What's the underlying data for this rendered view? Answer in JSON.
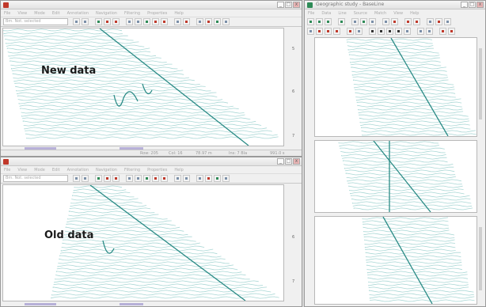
{
  "windows": {
    "new": {
      "menu": [
        "File",
        "View",
        "Mode",
        "Edit",
        "Annotation",
        "Navigation",
        "Filtering",
        "Properties",
        "Help"
      ],
      "combo": "Bm. Not. selected",
      "overlay_label": "New data",
      "depth_labels": [
        "5",
        "6",
        "7"
      ],
      "status": [
        "Row: 205",
        "Col: 16",
        "78.97 m",
        "Ins: 7 Bla",
        "991.0 s"
      ]
    },
    "old": {
      "menu": [
        "File",
        "View",
        "Mode",
        "Edit",
        "Annotation",
        "Navigation",
        "Filtering",
        "Properties",
        "Help"
      ],
      "combo": "Bm. Not. selected",
      "overlay_label": "Old data",
      "depth_labels": [
        "6",
        "7"
      ]
    },
    "right": {
      "title": "Geographic study - BaseLine",
      "menu": [
        "File",
        "Data",
        "Line",
        "Source",
        "Match",
        "View",
        "Help"
      ]
    }
  },
  "colors": {
    "trace": "#a9d7d5",
    "event": "#2b8b86",
    "accent_strip": "#b7b0d8",
    "icon_red": "#c0392b",
    "icon_green": "#2e8b57"
  }
}
